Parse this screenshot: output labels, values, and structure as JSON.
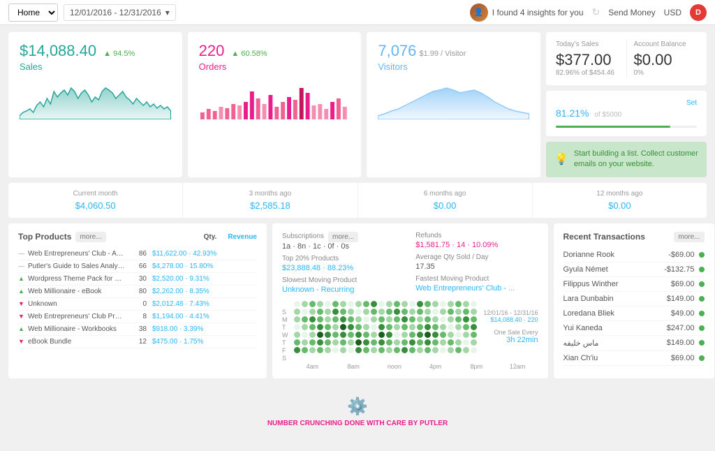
{
  "header": {
    "home_label": "Home",
    "date_range": "12/01/2016 - 12/31/2016",
    "insights_text": "I found 4 insights for you",
    "send_money": "Send Money",
    "currency": "USD",
    "user_initial": "D"
  },
  "kpi": {
    "sales": {
      "value": "$14,088.40",
      "badge": "▲ 94.5%",
      "label": "Sales"
    },
    "orders": {
      "value": "220",
      "badge": "▲ 60.58%",
      "label": "Orders"
    },
    "visitors": {
      "value": "7,076",
      "subtitle": "$1.99 / Visitor",
      "label": "Visitors"
    }
  },
  "right_panel": {
    "todays_sales_label": "Today's Sales",
    "todays_sales_value": "$377.00",
    "todays_sales_sub": "82.96% of $454.46",
    "account_balance_label": "Account Balance",
    "account_balance_value": "$0.00",
    "account_balance_sub": "0%",
    "goal_percent": "81.21",
    "goal_of": "of $5000",
    "goal_bar_width": "81",
    "set_label": "Set",
    "promo_text": "Start building a list. Collect customer emails on your website."
  },
  "time_comparisons": [
    {
      "label": "Current month",
      "value": "$4,060.50"
    },
    {
      "label": "3 months ago",
      "value": "$2,585.18"
    },
    {
      "label": "6 months ago",
      "value": "$0.00"
    },
    {
      "label": "12 months ago",
      "value": "$0.00"
    }
  ],
  "top_products": {
    "title": "Top Products",
    "more": "more...",
    "qty_header": "Qty.",
    "rev_header": "Revenue",
    "items": [
      {
        "icon": "neutral",
        "name": "Web Entrepreneurs' Club - An...",
        "qty": "86",
        "rev": "$11,622.00 · 42.93%",
        "trend": "neutral"
      },
      {
        "icon": "neutral",
        "name": "Putler's Guide to Sales Analysi...",
        "qty": "66",
        "rev": "$4,278.00 · 15.80%",
        "trend": "neutral"
      },
      {
        "icon": "up",
        "name": "Wordpress Theme Pack for We...",
        "qty": "30",
        "rev": "$2,520.00 · 9.31%",
        "trend": "up"
      },
      {
        "icon": "up",
        "name": "Web Millionaire - eBook",
        "qty": "80",
        "rev": "$2,262.00 · 8.35%",
        "trend": "up"
      },
      {
        "icon": "down",
        "name": "Unknown",
        "qty": "0",
        "rev": "$2,012.48 · 7.43%",
        "trend": "down"
      },
      {
        "icon": "down",
        "name": "Web Entrepreneurs' Club Prem...",
        "qty": "8",
        "rev": "$1,194.00 · 4.41%",
        "trend": "down"
      },
      {
        "icon": "up",
        "name": "Web Millionaire - Workbooks",
        "qty": "38",
        "rev": "$918.00 · 3.39%",
        "trend": "up"
      },
      {
        "icon": "down",
        "name": "eBook Bundle",
        "qty": "12",
        "rev": "$475.00 · 1.75%",
        "trend": "down"
      }
    ]
  },
  "mid_section": {
    "subscriptions_label": "Subscriptions",
    "subscriptions_more": "more...",
    "subscriptions_value": "1a · 8n · 1c · 0f · 0s",
    "top20_label": "Top 20% Products",
    "top20_value": "$23,888.48 · 88.23%",
    "slowest_label": "Slowest Moving Product",
    "slowest_value": "Unknown - Recurring",
    "refunds_label": "Refunds",
    "refunds_value": "$1,581.75 · 14 · 10.09%",
    "avg_qty_label": "Average Qty Sold / Day",
    "avg_qty_value": "17.35",
    "fastest_label": "Fastest Moving Product",
    "fastest_value": "Web Entrepreneurs' Club - ...",
    "heatmap_date": "12/01/16 - 12/31/16",
    "heatmap_total": "$14,088.40 · 220",
    "one_sale": "One Sale Every",
    "sale_freq": "3h 22min",
    "heatmap_time_labels": [
      "4am",
      "8am",
      "noon",
      "4pm",
      "8pm",
      "12am"
    ],
    "heatmap_day_labels": [
      "S",
      "M",
      "T",
      "W",
      "T",
      "F",
      "S"
    ]
  },
  "transactions": {
    "title": "Recent Transactions",
    "more": "more...",
    "items": [
      {
        "name": "Dorianne Rook",
        "amount": "-$69.00",
        "dot": "green"
      },
      {
        "name": "Gyula Német",
        "amount": "-$132.75",
        "dot": "green"
      },
      {
        "name": "Filippus Winther",
        "amount": "$69.00",
        "dot": "green"
      },
      {
        "name": "Lara Dunbabin",
        "amount": "$149.00",
        "dot": "green"
      },
      {
        "name": "Loredana Bliek",
        "amount": "$49.00",
        "dot": "green"
      },
      {
        "name": "Yui Kaneda",
        "amount": "$247.00",
        "dot": "green"
      },
      {
        "name": "ماس خليفه",
        "amount": "$149.00",
        "dot": "green"
      },
      {
        "name": "Xian Ch'iu",
        "amount": "$69.00",
        "dot": "green"
      }
    ]
  },
  "footer": {
    "text": "NUMBER CRUNCHING DONE WITH CARE BY",
    "brand": "PUTLER"
  }
}
